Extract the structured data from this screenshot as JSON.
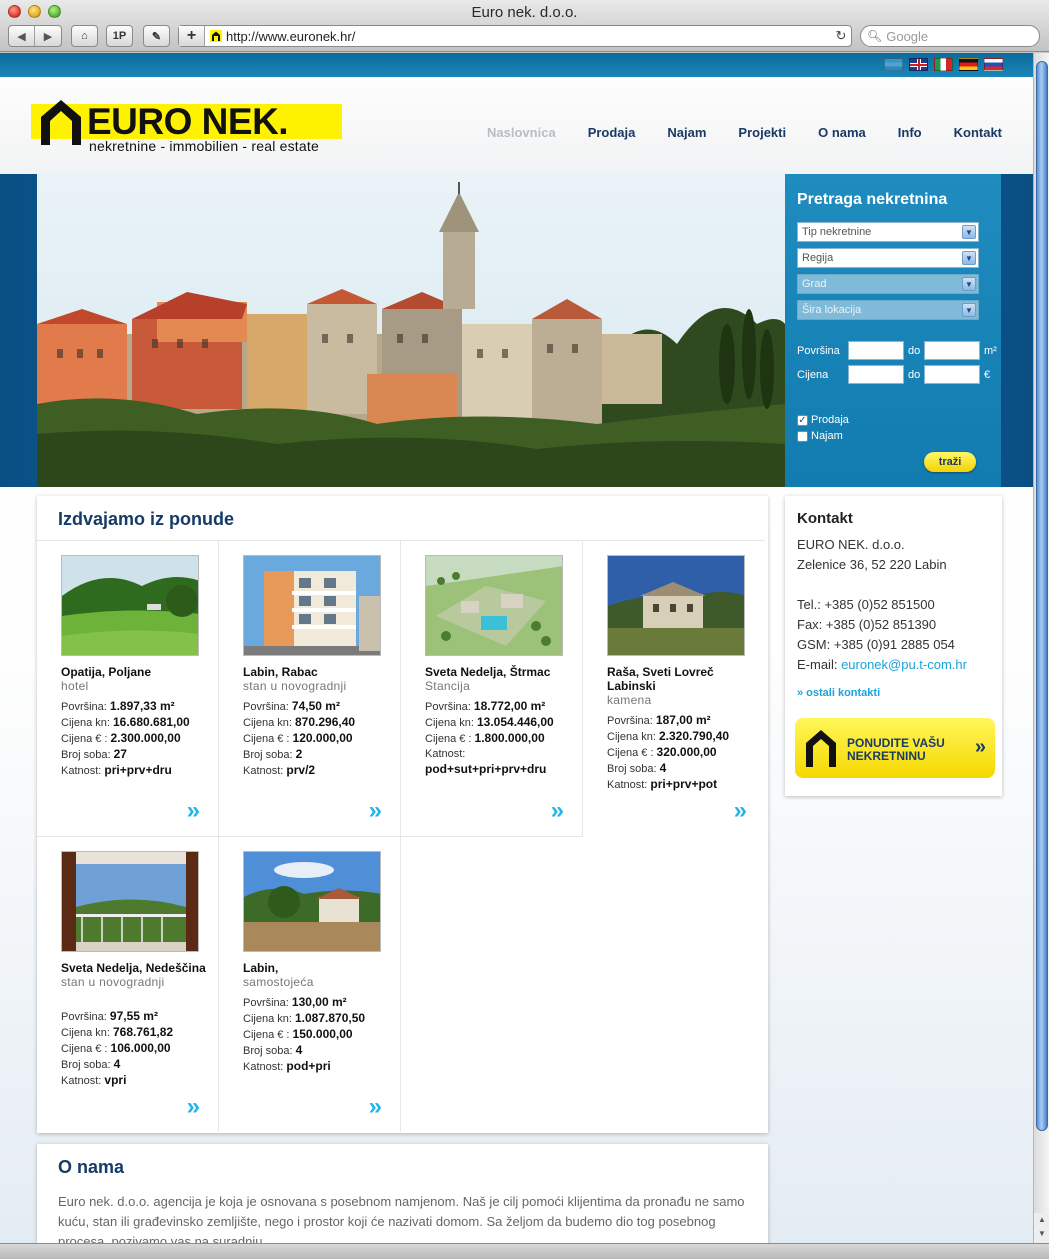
{
  "window": {
    "title": "Euro nek. d.o.o."
  },
  "toolbar": {
    "back_label": "◀",
    "forward_label": "▶",
    "home_label": "⌂",
    "onep_label": "1P",
    "bookmark_label": "✎",
    "add_label": "+",
    "url": "http://www.euronek.hr/",
    "reload_label": "↻",
    "search_placeholder": "Google"
  },
  "languages": [
    "hr",
    "en",
    "it",
    "de",
    "ru"
  ],
  "logo": {
    "word": "EURO NEK.",
    "tagline": "nekretnine - immobilien - real estate"
  },
  "nav": [
    {
      "label": "Naslovnica",
      "active": true
    },
    {
      "label": "Prodaja"
    },
    {
      "label": "Najam"
    },
    {
      "label": "Projekti"
    },
    {
      "label": "O nama"
    },
    {
      "label": "Info"
    },
    {
      "label": "Kontakt"
    }
  ],
  "search": {
    "title": "Pretraga nekretnina",
    "select_type": "Tip nekretnine",
    "select_region": "Regija",
    "select_city": "Grad",
    "select_location": "Šira lokacija",
    "area_label": "Površina",
    "price_label": "Cijena",
    "to_label": "do",
    "area_unit": "m²",
    "price_unit": "€",
    "check_sale": "Prodaja",
    "check_rent": "Najam",
    "button": "traži",
    "sale_checked": true,
    "rent_checked": false
  },
  "offers": {
    "title": "Izdvajamo iz ponude",
    "items": [
      {
        "loc1": "Opatija",
        "loc2": "Poljane",
        "type": "hotel",
        "area_label": "Površina:",
        "area": "1.897,33 m²",
        "kn_label": "Cijena kn:",
        "kn": "16.680.681,00",
        "eur_label": "Cijena € :",
        "eur": "2.300.000,00",
        "rooms_label": "Broj soba:",
        "rooms": "27",
        "floors_label": "Katnost:",
        "floors": "pri+prv+dru"
      },
      {
        "loc1": "Labin",
        "loc2": "Rabac",
        "type": "stan u novogradnji",
        "area_label": "Površina:",
        "area": "74,50 m²",
        "kn_label": "Cijena kn:",
        "kn": "870.296,40",
        "eur_label": "Cijena € :",
        "eur": "120.000,00",
        "rooms_label": "Broj soba:",
        "rooms": "2",
        "floors_label": "Katnost:",
        "floors": "prv/2"
      },
      {
        "loc1": "Sveta Nedelja",
        "loc2": "Štrmac",
        "type": "Stancija",
        "area_label": "Površina:",
        "area": "18.772,00 m²",
        "kn_label": "Cijena kn:",
        "kn": "13.054.446,00",
        "eur_label": "Cijena € :",
        "eur": "1.800.000,00",
        "rooms_label": "",
        "rooms": "",
        "floors_label": "Katnost:",
        "floors": "pod+sut+pri+prv+dru"
      },
      {
        "loc1": "Raša",
        "loc2": "Sveti Lovreč Labinski",
        "type": "kamena",
        "area_label": "Površina:",
        "area": "187,00 m²",
        "kn_label": "Cijena kn:",
        "kn": "2.320.790,40",
        "eur_label": "Cijena € :",
        "eur": "320.000,00",
        "rooms_label": "Broj soba:",
        "rooms": "4",
        "floors_label": "Katnost:",
        "floors": "pri+prv+pot"
      },
      {
        "loc1": "Sveta Nedelja",
        "loc2": "Nedeščina",
        "type": "stan u novogradnji",
        "area_label": "Površina:",
        "area": "97,55 m²",
        "kn_label": "Cijena kn:",
        "kn": "768.761,82",
        "eur_label": "Cijena € :",
        "eur": "106.000,00",
        "rooms_label": "Broj soba:",
        "rooms": "4",
        "floors_label": "Katnost:",
        "floors": "vpri"
      },
      {
        "loc1": "Labin",
        "loc2": "",
        "type": "samostojeća",
        "area_label": "Površina:",
        "area": "130,00 m²",
        "kn_label": "Cijena kn:",
        "kn": "1.087.870,50",
        "eur_label": "Cijena € :",
        "eur": "150.000,00",
        "rooms_label": "Broj soba:",
        "rooms": "4",
        "floors_label": "Katnost:",
        "floors": "pod+pri"
      }
    ],
    "more_symbol": "»"
  },
  "contact": {
    "title": "Kontakt",
    "company": "EURO NEK. d.o.o.",
    "address": "Zelenice 36, 52 220 Labin",
    "tel": "Tel.: +385 (0)52 851500",
    "fax": "Fax: +385 (0)52 851390",
    "gsm": "GSM: +385 (0)91 2885 054",
    "email_label": "E-mail: ",
    "email": "euronek@pu.t-com.hr",
    "more": "» ostali kontakti",
    "offer_line1": "PONUDITE VAŠU",
    "offer_line2": "NEKRETNINU",
    "offer_arrow": "»"
  },
  "about": {
    "title": "O nama",
    "text": "Euro nek. d.o.o. agencija je koja je osnovana s posebnom namjenom. Naš je cilj pomoći klijentima da pronađu ne samo kuću, stan ili građevinsko zemljište, nego i prostor koji će nazivati domom. Sa željom da budemo dio tog posebnog procesa, pozivamo vas na suradnju."
  },
  "colors": {
    "brand_yellow": "#fff200",
    "nav_blue": "#1b3a63",
    "accent_cyan": "#25b5e8",
    "panel_blue": "#1f8cbf"
  }
}
